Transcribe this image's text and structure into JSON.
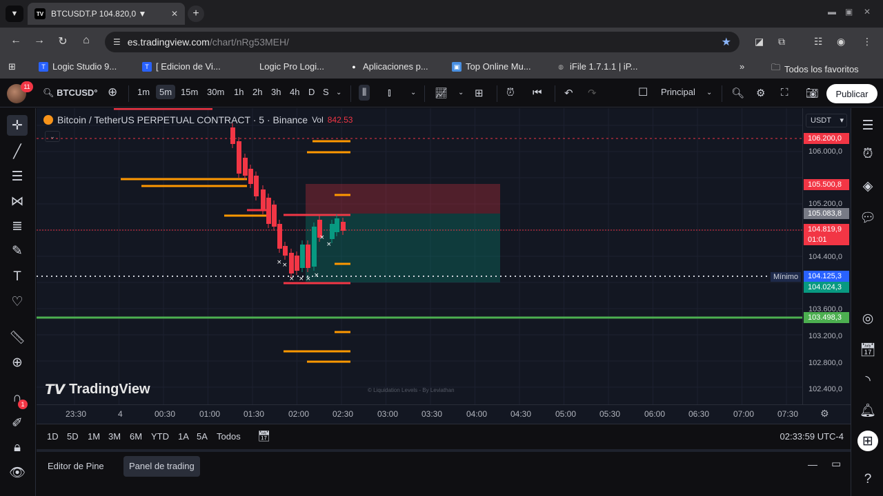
{
  "browser": {
    "tab_title": "BTCUSDT.P 104.820,0 ▼",
    "tab_favicon": "TV",
    "url_host": "es.tradingview.com",
    "url_path": "/chart/nRg53MEH/",
    "bookmarks": [
      {
        "label": "Logic Studio 9...",
        "icon": "tv-icon",
        "color": "#2962ff"
      },
      {
        "label": "[ Edicion de Vi...",
        "icon": "doc-icon",
        "color": "#2962ff"
      },
      {
        "label": "Logic Pro Logi...",
        "icon": "",
        "color": ""
      },
      {
        "label": "Aplicaciones p...",
        "icon": "apple-icon",
        "color": "#ffffff"
      },
      {
        "label": "Top Online Mu...",
        "icon": "music-icon",
        "color": "#4a90e2"
      },
      {
        "label": "iFile 1.7.1.1 | iP...",
        "icon": "globe-icon",
        "color": "#aaaaaa"
      }
    ],
    "all_bookmarks": "Todos los favoritos"
  },
  "toolbar": {
    "notification_count": "11",
    "symbol": "BTCUSD°",
    "intervals": [
      "1m",
      "5m",
      "15m",
      "30m",
      "1h",
      "2h",
      "3h",
      "4h",
      "D",
      "S"
    ],
    "active_interval": "5m",
    "layout_label": "Principal",
    "publish_label": "Publicar"
  },
  "chart": {
    "title": "Bitcoin / TetherUS PERPETUAL CONTRACT · 5 · Binance",
    "vol_label": "Vol",
    "vol_value": "842.53",
    "currency": "USDT",
    "watermark": "TradingView",
    "indicator_credit": "© Liquidation Levels - By Leviathan",
    "minimo_label": "Mínimo",
    "price_ticks": [
      "106.000,0",
      "105.200,0",
      "104.400,0",
      "103.600,0",
      "103.200,0",
      "102.800,0",
      "102.400,0"
    ],
    "price_labels": [
      {
        "text": "106.200,0",
        "color": "#f23645"
      },
      {
        "text": "105.500,8",
        "color": "#f23645"
      },
      {
        "text": "105.083,8",
        "color": "#787b86"
      },
      {
        "text": "104.819,9",
        "color": "#f23645"
      },
      {
        "text": "01:01",
        "color": "#f23645"
      },
      {
        "text": "104.125,3",
        "color": "#2962ff"
      },
      {
        "text": "104.024,3",
        "color": "#089981"
      },
      {
        "text": "103.498,3",
        "color": "#4caf50"
      }
    ],
    "time_ticks": [
      "23:30",
      "4",
      "00:30",
      "01:00",
      "01:30",
      "02:00",
      "02:30",
      "03:00",
      "03:30",
      "04:00",
      "04:30",
      "05:00",
      "05:30",
      "06:00",
      "06:30",
      "07:00",
      "07:30"
    ]
  },
  "ranges": [
    "1D",
    "5D",
    "1M",
    "3M",
    "6M",
    "YTD",
    "1A",
    "5A",
    "Todos"
  ],
  "clock": "02:33:59 UTC-4",
  "bottom_tabs": [
    "Editor de Pine",
    "Panel de trading"
  ],
  "right_badge": "1"
}
